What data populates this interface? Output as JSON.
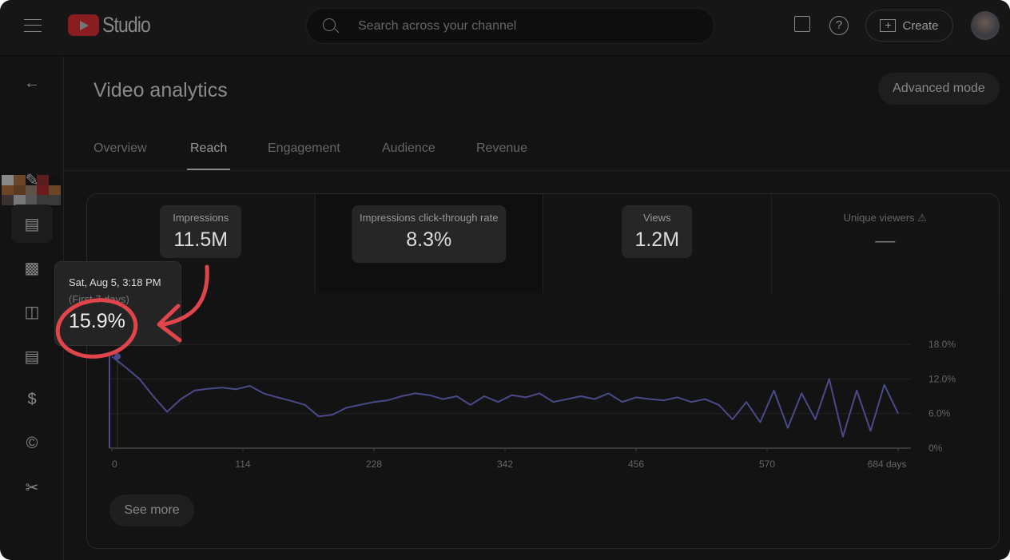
{
  "header": {
    "logo_text": "Studio",
    "search_placeholder": "Search across your channel",
    "create_label": "Create",
    "icons": [
      "menu-icon",
      "feedback-icon",
      "help-icon",
      "create-video-icon"
    ]
  },
  "sidebar": {
    "items": [
      "back-icon",
      "edit-icon",
      "analytics-icon",
      "editor-icon",
      "comments-icon",
      "subtitles-icon",
      "monetization-icon",
      "copyright-icon",
      "clips-icon"
    ],
    "selected": "analytics-icon"
  },
  "page": {
    "title": "Video analytics",
    "advanced_mode": "Advanced mode",
    "see_more": "See more"
  },
  "tabs": [
    {
      "label": "Overview"
    },
    {
      "label": "Reach",
      "active": true
    },
    {
      "label": "Engagement"
    },
    {
      "label": "Audience"
    },
    {
      "label": "Revenue"
    }
  ],
  "metrics": [
    {
      "label": "Impressions",
      "value": "11.5M"
    },
    {
      "label": "Impressions click-through rate",
      "value": "8.3%",
      "selected": true
    },
    {
      "label": "Views",
      "value": "1.2M"
    },
    {
      "label": "Unique viewers",
      "value": "—",
      "warning": true
    }
  ],
  "tooltip": {
    "date": "Sat, Aug 5, 3:18 PM",
    "subtitle": "(First 7 days)",
    "value": "15.9%"
  },
  "colors": {
    "line": "#4a4a8a",
    "annotation": "#e0454b",
    "logo": "#8a1d1f"
  },
  "chart_data": {
    "type": "line",
    "x_unit": "days",
    "xticks": [
      "0",
      "114",
      "228",
      "342",
      "456",
      "570",
      "684 days"
    ],
    "yticks": [
      "0%",
      "6.0%",
      "12.0%",
      "18.0%"
    ],
    "xlim": [
      0,
      684
    ],
    "ylim": [
      0,
      18
    ],
    "grid": true,
    "x": [
      0,
      12,
      24,
      36,
      48,
      60,
      72,
      84,
      96,
      108,
      120,
      132,
      144,
      156,
      168,
      180,
      192,
      204,
      216,
      228,
      240,
      252,
      264,
      276,
      288,
      300,
      312,
      324,
      336,
      348,
      360,
      372,
      384,
      396,
      408,
      420,
      432,
      444,
      456,
      468,
      480,
      492,
      504,
      516,
      528,
      540,
      552,
      564,
      576,
      588,
      600,
      612,
      624,
      636,
      648,
      660,
      672,
      684
    ],
    "y": [
      15.9,
      14.0,
      12.0,
      9.0,
      6.3,
      8.5,
      10.0,
      10.3,
      10.5,
      10.2,
      10.8,
      9.5,
      8.8,
      8.2,
      7.5,
      5.5,
      5.8,
      7.0,
      7.5,
      8.0,
      8.3,
      9.0,
      9.5,
      9.2,
      8.5,
      9.0,
      7.5,
      9.0,
      8.0,
      9.2,
      8.8,
      9.5,
      8.0,
      8.5,
      9.0,
      8.5,
      9.5,
      8.0,
      8.8,
      8.5,
      8.3,
      8.8,
      8.0,
      8.5,
      7.5,
      5.0,
      8.0,
      4.5,
      10.0,
      3.5,
      9.5,
      5.0,
      12.0,
      2.0,
      10.0,
      3.0,
      11.0,
      6.0
    ]
  }
}
